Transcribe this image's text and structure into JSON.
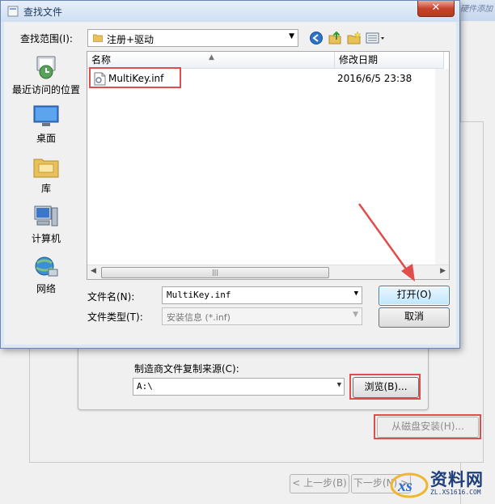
{
  "background_wizard": {
    "topright_text": "硬件添加",
    "right_label": "磁",
    "source_label": "制造商文件复制来源(C):",
    "source_value": "A:\\",
    "browse_label": "浏览(B)...",
    "from_disk_label": "从磁盘安装(H)...",
    "back_label": "< 上一步(B)",
    "next_label": "下一步(N) >"
  },
  "dialog": {
    "title": "查找文件",
    "close_label": "✕",
    "lookin_label": "查找范围(I):",
    "lookin_value": "注册+驱动",
    "places": [
      {
        "label": "最近访问的位置",
        "icon": "recent-places-icon"
      },
      {
        "label": "桌面",
        "icon": "desktop-icon"
      },
      {
        "label": "库",
        "icon": "libraries-icon"
      },
      {
        "label": "计算机",
        "icon": "computer-icon"
      },
      {
        "label": "网络",
        "icon": "network-icon"
      }
    ],
    "columns": {
      "name": "名称",
      "date": "修改日期"
    },
    "files": [
      {
        "name": "MultiKey.inf",
        "date": "2016/6/5 23:38",
        "icon": "inf-file-icon"
      }
    ],
    "filename_label": "文件名(N):",
    "filename_value": "MultiKey.inf",
    "filetype_label": "文件类型(T):",
    "filetype_value": "安装信息 (*.inf)",
    "open_label": "打开(O)",
    "cancel_label": "取消"
  },
  "watermark": {
    "text": "资料网",
    "sub": "ZL.XS1616.COM"
  },
  "colors": {
    "annotation_red": "#e14c4c",
    "dialog_frame": "#dbe7f5"
  }
}
